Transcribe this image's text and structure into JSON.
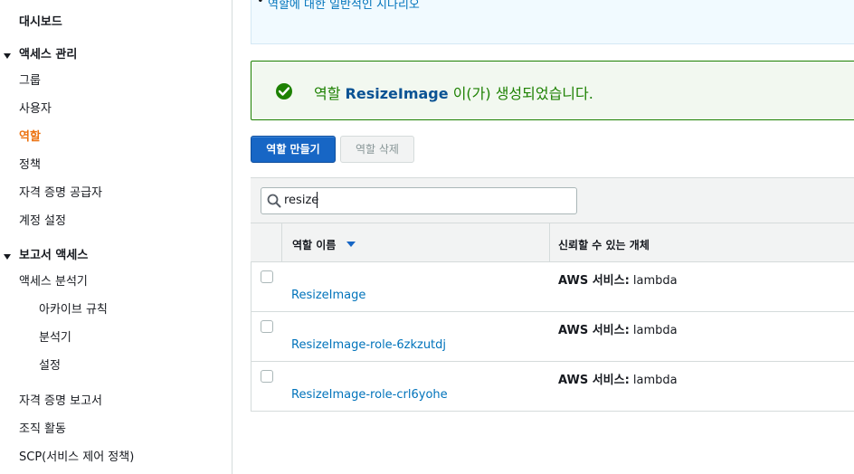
{
  "sidebar": {
    "dashboard": "대시보드",
    "access_mgmt": {
      "label": "액세스 관리",
      "items": [
        "그룹",
        "사용자",
        "역할",
        "정책",
        "자격 증명 공급자",
        "계정 설정"
      ]
    },
    "access_reports": {
      "label": "보고서 액세스",
      "analyzer": "액세스 분석기",
      "analyzer_sub": [
        "아카이브 규칙",
        "분석기",
        "설정"
      ],
      "items": [
        "자격 증명 보고서",
        "조직 활동",
        "SCP(서비스 제어 정책)"
      ]
    }
  },
  "info": {
    "bullet": "역할에 대한 일반적인 시나리오"
  },
  "success": {
    "prefix": "역할 ",
    "role_name": "ResizeImage",
    "suffix": " 이(가) 생성되었습니다.",
    "color": "#1d8102"
  },
  "buttons": {
    "create": "역할 만들기",
    "delete": "역할 삭제"
  },
  "search": {
    "value": "resize"
  },
  "table": {
    "columns": [
      "역할 이름",
      "신뢰할 수 있는 개체"
    ],
    "rows": [
      {
        "name": "ResizeImage",
        "trust_label": "AWS 서비스:",
        "trust_value": " lambda"
      },
      {
        "name": "ResizeImage-role-6zkzutdj",
        "trust_label": "AWS 서비스:",
        "trust_value": " lambda"
      },
      {
        "name": "ResizeImage-role-crl6yohe",
        "trust_label": "AWS 서비스:",
        "trust_value": " lambda"
      }
    ]
  }
}
